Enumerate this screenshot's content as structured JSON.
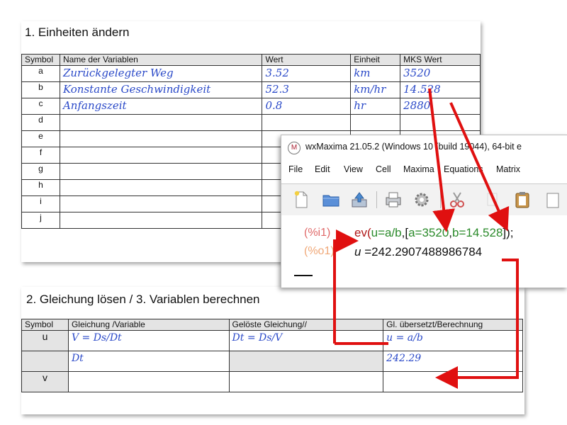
{
  "section1": {
    "title": "1. Einheiten ändern",
    "headers": [
      "Symbol",
      "Name der Variablen",
      "Wert",
      "Einheit",
      "MKS Wert"
    ],
    "rows": [
      {
        "symbol": "a",
        "name": "Zurückgelegter Weg",
        "wert": "3.52",
        "einheit": "km",
        "mks": "3520"
      },
      {
        "symbol": "b",
        "name": "Konstante Geschwindigkeit",
        "wert": "52.3",
        "einheit": "km/hr",
        "mks": "14.528"
      },
      {
        "symbol": "c",
        "name": "Anfangszeit",
        "wert": "0.8",
        "einheit": "hr",
        "mks": "2880"
      },
      {
        "symbol": "d",
        "name": "",
        "wert": "",
        "einheit": "",
        "mks": ""
      },
      {
        "symbol": "e",
        "name": "",
        "wert": "",
        "einheit": "",
        "mks": ""
      },
      {
        "symbol": "f",
        "name": "",
        "wert": "",
        "einheit": "",
        "mks": ""
      },
      {
        "symbol": "g",
        "name": "",
        "wert": "",
        "einheit": "",
        "mks": ""
      },
      {
        "symbol": "h",
        "name": "",
        "wert": "",
        "einheit": "",
        "mks": ""
      },
      {
        "symbol": "i",
        "name": "",
        "wert": "",
        "einheit": "",
        "mks": ""
      },
      {
        "symbol": "j",
        "name": "",
        "wert": "",
        "einheit": "",
        "mks": ""
      }
    ]
  },
  "section2": {
    "title": "2. Gleichung lösen / 3. Variablen berechnen",
    "headers": [
      "Symbol",
      "Gleichung /Variable",
      "Gelöste Gleichung//",
      "Gl. übersetzt/Berechnung"
    ],
    "rows": [
      {
        "symbol": "u",
        "gleichung": "V = Ds/Dt",
        "geloest": "Dt = Ds/V",
        "berechnung": "u = a/b"
      },
      {
        "symbol": "",
        "gleichung": "Dt",
        "geloest": "",
        "berechnung": "242.29"
      },
      {
        "symbol": "v",
        "gleichung": "",
        "geloest": "",
        "berechnung": ""
      }
    ]
  },
  "wxmaxima": {
    "title": "wxMaxima 21.05.2 (Windows 10 (build 19044), 64-bit e",
    "logo_letter": "M",
    "menu": [
      "File",
      "Edit",
      "View",
      "Cell",
      "Maxima",
      "Equations",
      "Matrix"
    ],
    "toolbar_icons": [
      "new-file-icon",
      "open-folder-icon",
      "save-icon",
      "print-icon",
      "settings-gear-icon",
      "cut-scissors-icon",
      "copy-icon",
      "paste-clipboard-icon"
    ],
    "input_label": "(%i1)",
    "output_label": "(%o1)",
    "input_parts": {
      "fn": "ev(",
      "expr": "u=a/b",
      "sep": ",[",
      "a": "a=3520",
      "comma": ",",
      "b": "b=14.528",
      "end": "]);"
    },
    "output_var": "u",
    "output_eq": " =",
    "output_value": "242.2907488986784"
  },
  "colors": {
    "handwriting": "#2a49c8",
    "arrow": "#e01010",
    "header_bg": "#e4e4e4"
  }
}
